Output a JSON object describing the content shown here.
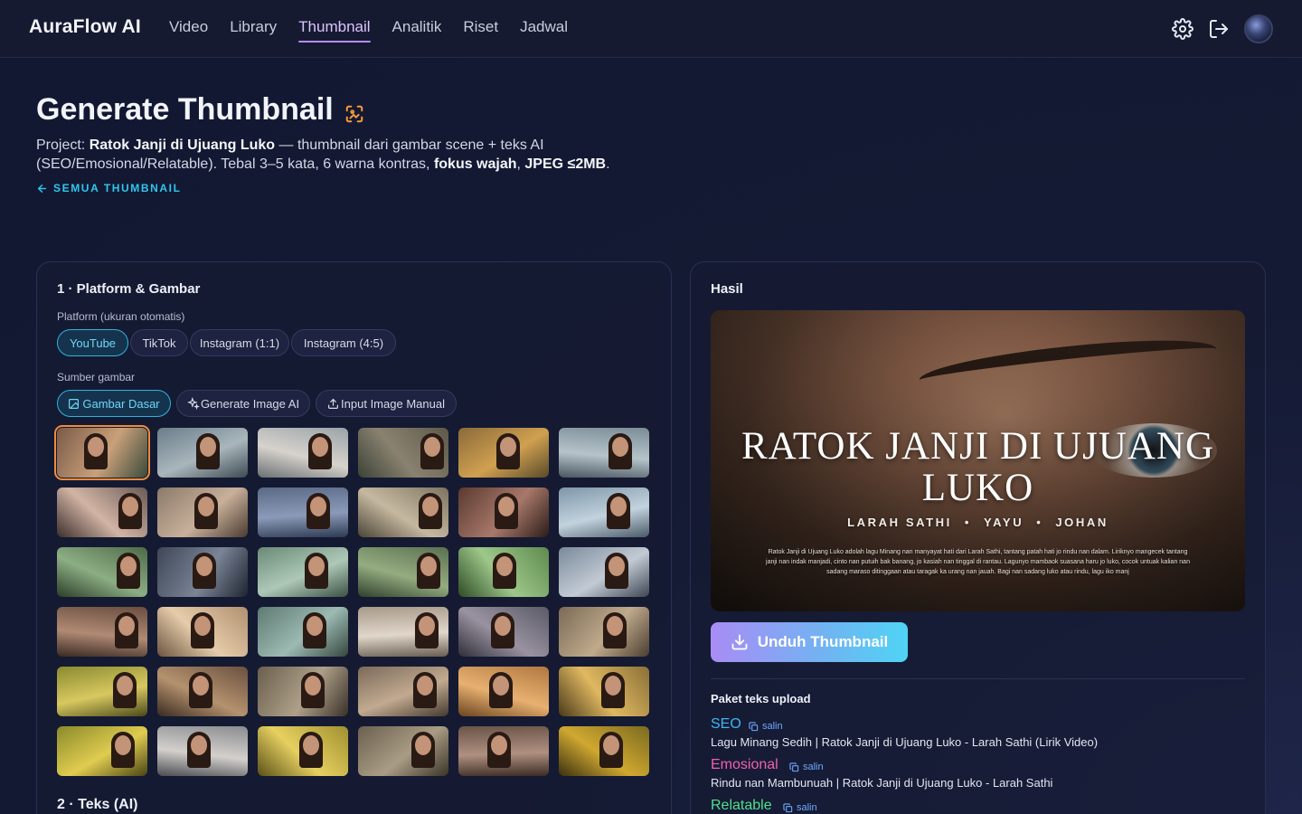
{
  "nav": {
    "brand": "AuraFlow AI",
    "links": [
      "Video",
      "Library",
      "Thumbnail",
      "Analitik",
      "Riset",
      "Jadwal"
    ],
    "active": "Thumbnail",
    "icons": [
      "gear-icon",
      "logout-icon",
      "avatar"
    ]
  },
  "header": {
    "title": "Generate Thumbnail",
    "desc_prefix": "Project: ",
    "project_name": "Ratok Janji di Ujuang Luko",
    "desc_mid": " — thumbnail dari gambar scene + teks AI (SEO/Emosional/Relatable). Tebal 3–5 kata, 6 warna kontras, ",
    "desc_bold1": "fokus wajah",
    "desc_sep": ", ",
    "desc_bold2": "JPEG ≤2MB",
    "desc_end": ".",
    "back_label": "SEMUA THUMBNAIL"
  },
  "left_panel": {
    "title": "1 · Platform & Gambar",
    "platform_label": "Platform (ukuran otomatis)",
    "platforms": [
      "YouTube",
      "TikTok",
      "Instagram (1:1)",
      "Instagram (4:5)"
    ],
    "platform_selected": "YouTube",
    "source_label": "Sumber gambar",
    "sources": [
      "Gambar Dasar",
      "Generate Image AI",
      "Input Image Manual"
    ],
    "source_selected": "Gambar Dasar",
    "thumbnails_count_rows": 6,
    "thumbnails_count_cols": 6,
    "selected_thumbnail": 0,
    "section2_title": "2 · Teks (AI)"
  },
  "right_panel": {
    "title": "Hasil",
    "preview": {
      "title_line1": "RATOK JANJI DI UJUANG",
      "title_line2": "LUKO",
      "name1": "LARAH SATHI",
      "name2": "YAYU",
      "name3": "JOHAN",
      "separator": "•",
      "caption": "Ratok Janji di Ujuang Luko adolah lagu Minang nan manyayat hati dari Larah Sathi, tantang patah hati jo rindu nan dalam. Liriknyo mangecek tantang janji nan indak manjadi, cinto nan putuih bak banang, jo kasiah nan tinggal di rantau. Lagunyo mambaok suasana haru jo luko, cocok untuak kalian nan sadang maraso ditinggaan atau taragak ka urang nan jauah. Bagi nan sadang luko atau rindu, lagu iko manj"
    },
    "download_label": "Unduh Thumbnail",
    "pack_title": "Paket teks upload",
    "copy_label": "salin",
    "packs": [
      {
        "label": "SEO",
        "color": "#3fb5f2",
        "text": "Lagu Minang Sedih | Ratok Janji di Ujuang Luko - Larah Sathi (Lirik Video)"
      },
      {
        "label": "Emosional",
        "color": "#f060b0",
        "text": "Rindu nan Mambunuah | Ratok Janji di Ujuang Luko - Larah Sathi"
      },
      {
        "label": "Relatable",
        "color": "#4fe08a",
        "text": ""
      }
    ]
  }
}
